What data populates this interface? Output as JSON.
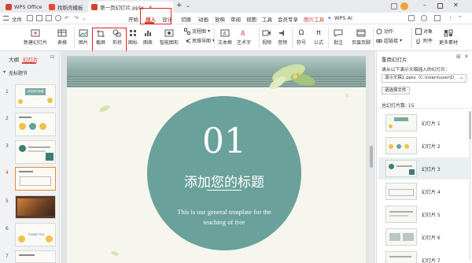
{
  "titlebar": {
    "tabs": [
      {
        "label": "WPS Office"
      },
      {
        "label": "找稻壳模板"
      },
      {
        "label": "第一页幻灯片.pptx"
      }
    ],
    "new_tab": "+",
    "overflow": "⌄"
  },
  "menubar": {
    "file": "文件",
    "items": [
      "开始",
      "插入",
      "设计",
      "切换",
      "动画",
      "放映",
      "审阅",
      "视图",
      "工具",
      "会员专享"
    ],
    "context_tab": "图片工具",
    "ai": "WPS AI"
  },
  "ribbon": {
    "new_slide": "新建幻灯片",
    "table": "表格",
    "picture": "图片",
    "screenshot": "截屏",
    "shape": "形状",
    "icon": "图标",
    "chart": "图表",
    "smart_graphic": "智能图形",
    "flowchart": "流程图",
    "mindmap": "思维导图",
    "textbox": "文本框",
    "wordart": "艺术字",
    "video": "视频",
    "audio": "音频",
    "symbol": "符号",
    "formula": "公式",
    "comment": "批注",
    "header_footer": "页眉页脚",
    "action": "动作",
    "hyperlink": "超链接",
    "object": "对象",
    "attachment": "附件",
    "more": "更多素材"
  },
  "leftpanel": {
    "tab_outline": "大纲",
    "tab_slides": "幻灯片",
    "section_label": "无标题节",
    "thumb_texts": {
      "t1": "添加您的标题",
      "t6": "THANK YOU"
    },
    "numbers": [
      "1",
      "2",
      "3",
      "4",
      "5",
      "6",
      "7"
    ]
  },
  "slide": {
    "number": "01",
    "title": "添加您的标题",
    "subtitle_line1": "This is our general template for the",
    "subtitle_line2": "teaching of free"
  },
  "rightpanel": {
    "title": "重用幻灯片",
    "instruction": "请从以下演示文稿插入的幻灯片：",
    "file_value": "演示文稿1.pptx（C:\\Users\\user\\D",
    "choose_file": "请选择文件",
    "count_label": "总幻灯片数: 15",
    "slides": [
      "幻灯片 1",
      "幻灯片 2",
      "幻灯片 3",
      "幻灯片 4",
      "幻灯片 5",
      "幻灯片 6",
      "幻灯片 7"
    ]
  },
  "colors": {
    "accent": "#d6412f",
    "teal": "#6aa19a",
    "highlight": "#e02020"
  }
}
